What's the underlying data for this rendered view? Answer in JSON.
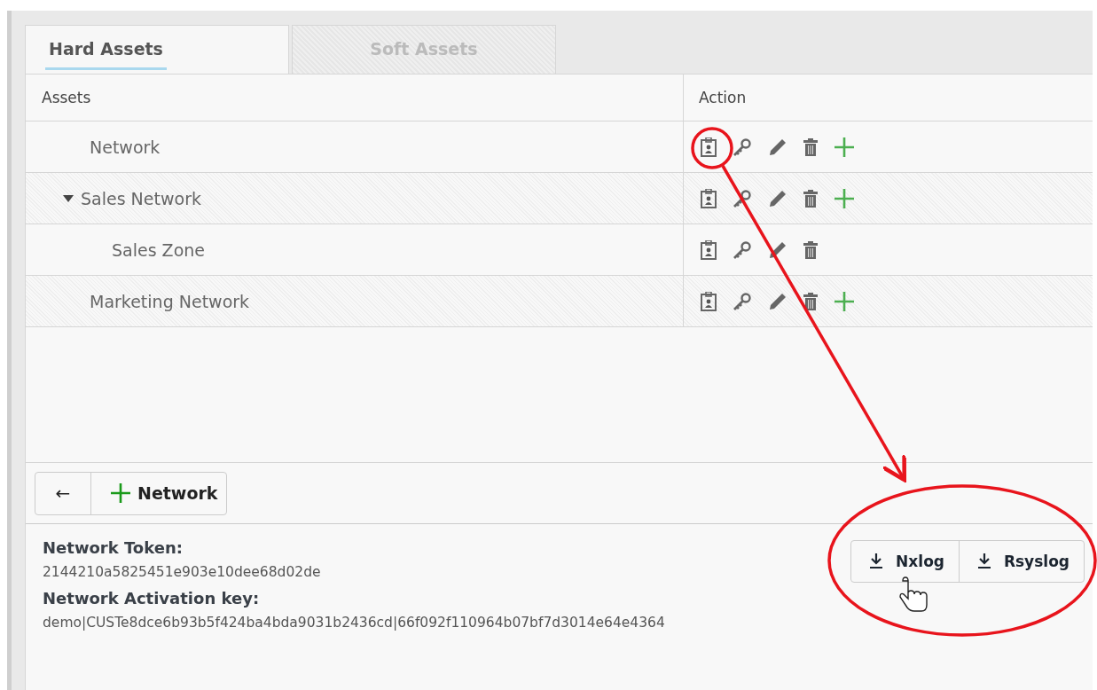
{
  "tabs": [
    {
      "label": "Hard Assets",
      "selected": true
    },
    {
      "label": "Soft Assets",
      "selected": false
    }
  ],
  "table": {
    "columns": [
      "Assets",
      "Action"
    ],
    "rows": [
      {
        "name": "Network",
        "can_add": true
      },
      {
        "name": "Sales Network",
        "expanded": true,
        "can_add": true,
        "children": [
          {
            "name": "Sales Zone",
            "can_add": false
          }
        ]
      },
      {
        "name": "Marketing Network",
        "can_add": true
      }
    ]
  },
  "toolbar": {
    "back": "←",
    "add": "Network"
  },
  "details": [
    {
      "label": "Network Token:",
      "value": "2144210a5825451e903e10dee68d02de"
    },
    {
      "label": "Network Activation key:",
      "value": "demo|CUSTe8dce6b93b5f424ba4bda9031b2436cd|66f092f110964b07bf7d3014e64e4364"
    }
  ],
  "downloads": [
    "Nxlog",
    "Rsyslog"
  ]
}
